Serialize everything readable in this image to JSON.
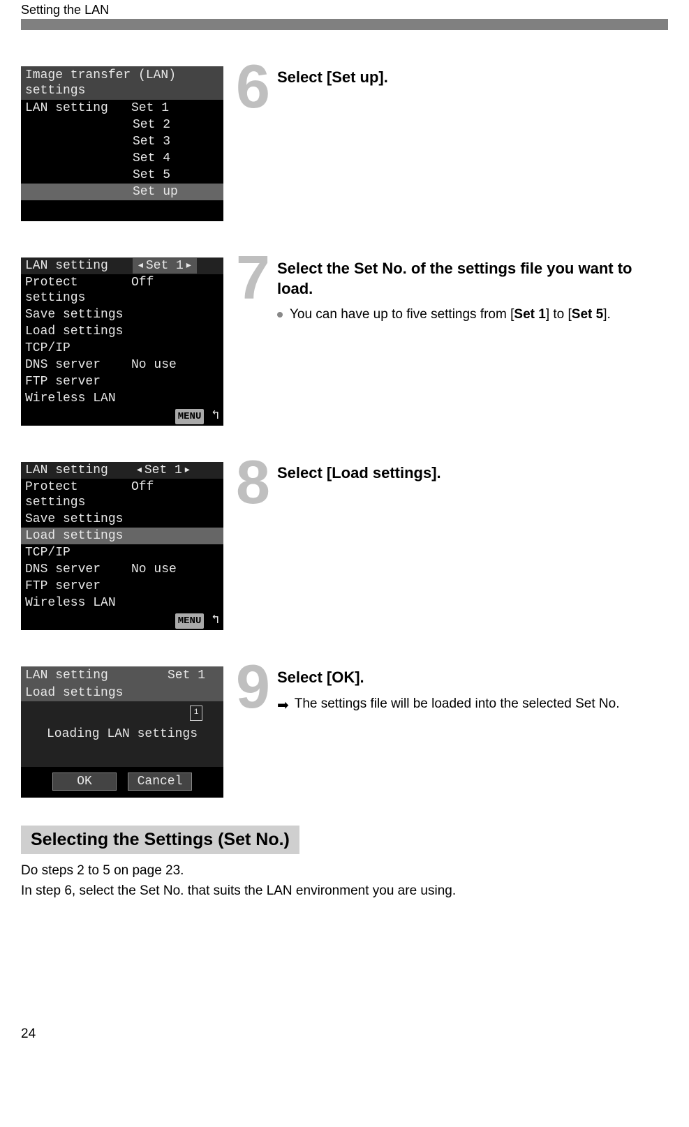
{
  "header": "Setting the LAN",
  "page_number": "24",
  "steps": {
    "s6": {
      "num": "6",
      "title": "Select [Set up].",
      "screen": {
        "title": "Image transfer (LAN) settings",
        "row_label": "LAN setting",
        "options": [
          "Set 1",
          "Set 2",
          "Set 3",
          "Set 4",
          "Set 5",
          "Set up"
        ]
      }
    },
    "s7": {
      "num": "7",
      "title": "Select the Set No. of the settings file you want to load.",
      "bullet_pre": "You can have up to five settings from [",
      "bullet_b1": "Set 1",
      "bullet_mid": "] to [",
      "bullet_b2": "Set 5",
      "bullet_post": "].",
      "screen": {
        "rows": [
          {
            "label": "LAN setting",
            "value": "Set 1",
            "selector": true
          },
          {
            "label": "Protect settings",
            "value": "Off"
          },
          {
            "label": "Save settings",
            "value": ""
          },
          {
            "label": "Load settings",
            "value": ""
          },
          {
            "label": "TCP/IP",
            "value": ""
          },
          {
            "label": "DNS server",
            "value": "No use"
          },
          {
            "label": "FTP server",
            "value": ""
          },
          {
            "label": "Wireless LAN",
            "value": ""
          }
        ],
        "menu": "MENU"
      }
    },
    "s8": {
      "num": "8",
      "title": "Select [Load settings].",
      "screen": {
        "rows": [
          {
            "label": "LAN setting",
            "value": "Set 1",
            "selector": true
          },
          {
            "label": "Protect settings",
            "value": "Off"
          },
          {
            "label": "Save settings",
            "value": ""
          },
          {
            "label": "Load settings",
            "value": "",
            "highlight": true
          },
          {
            "label": "TCP/IP",
            "value": ""
          },
          {
            "label": "DNS server",
            "value": "No use"
          },
          {
            "label": "FTP server",
            "value": ""
          },
          {
            "label": "Wireless LAN",
            "value": ""
          }
        ],
        "menu": "MENU"
      }
    },
    "s9": {
      "num": "9",
      "title": "Select [OK].",
      "arrow_text": "The settings file will be loaded into the selected Set No.",
      "screen": {
        "title_label": "LAN setting",
        "title_value": "Set 1",
        "sub": "Load settings",
        "card": "1",
        "message": "Loading LAN settings",
        "ok": "OK",
        "cancel": "Cancel"
      }
    }
  },
  "section": {
    "heading": "Selecting the Settings (Set No.)",
    "line1": "Do steps 2 to 5 on page 23.",
    "line2": "In step 6, select the Set No. that suits the LAN environment you are using."
  }
}
